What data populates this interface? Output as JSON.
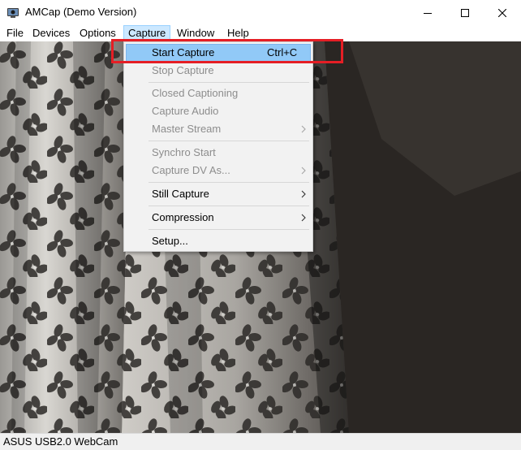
{
  "window": {
    "title": "AMCap (Demo Version)",
    "icon": "webcam-app-icon",
    "controls": [
      "minimize-icon",
      "maximize-icon",
      "close-icon"
    ]
  },
  "menubar": {
    "items": [
      {
        "label": "File"
      },
      {
        "label": "Devices"
      },
      {
        "label": "Options"
      },
      {
        "label": "Capture",
        "active": true
      },
      {
        "label": "Window"
      },
      {
        "label": "Help"
      }
    ]
  },
  "capture_menu": {
    "items": [
      {
        "label": "Start Capture",
        "shortcut": "Ctrl+C",
        "enabled": true,
        "highlighted": true
      },
      {
        "label": "Stop Capture",
        "enabled": false
      },
      {
        "label": "Closed Captioning",
        "enabled": false
      },
      {
        "label": "Capture Audio",
        "enabled": false
      },
      {
        "label": "Master Stream",
        "enabled": false,
        "submenu": true
      },
      {
        "label": "Synchro Start",
        "enabled": false
      },
      {
        "label": "Capture DV As...",
        "enabled": false,
        "submenu": true
      },
      {
        "label": "Still Capture",
        "enabled": true,
        "submenu": true
      },
      {
        "label": "Compression",
        "enabled": true,
        "submenu": true
      },
      {
        "label": "Setup...",
        "enabled": true
      }
    ]
  },
  "statusbar": {
    "text": "ASUS USB2.0 WebCam"
  },
  "colors": {
    "menu_highlight": "#91c9f7",
    "menubar_active": "#cce8ff",
    "annotation": "#e51e25",
    "disabled_text": "#8d8d8d"
  }
}
